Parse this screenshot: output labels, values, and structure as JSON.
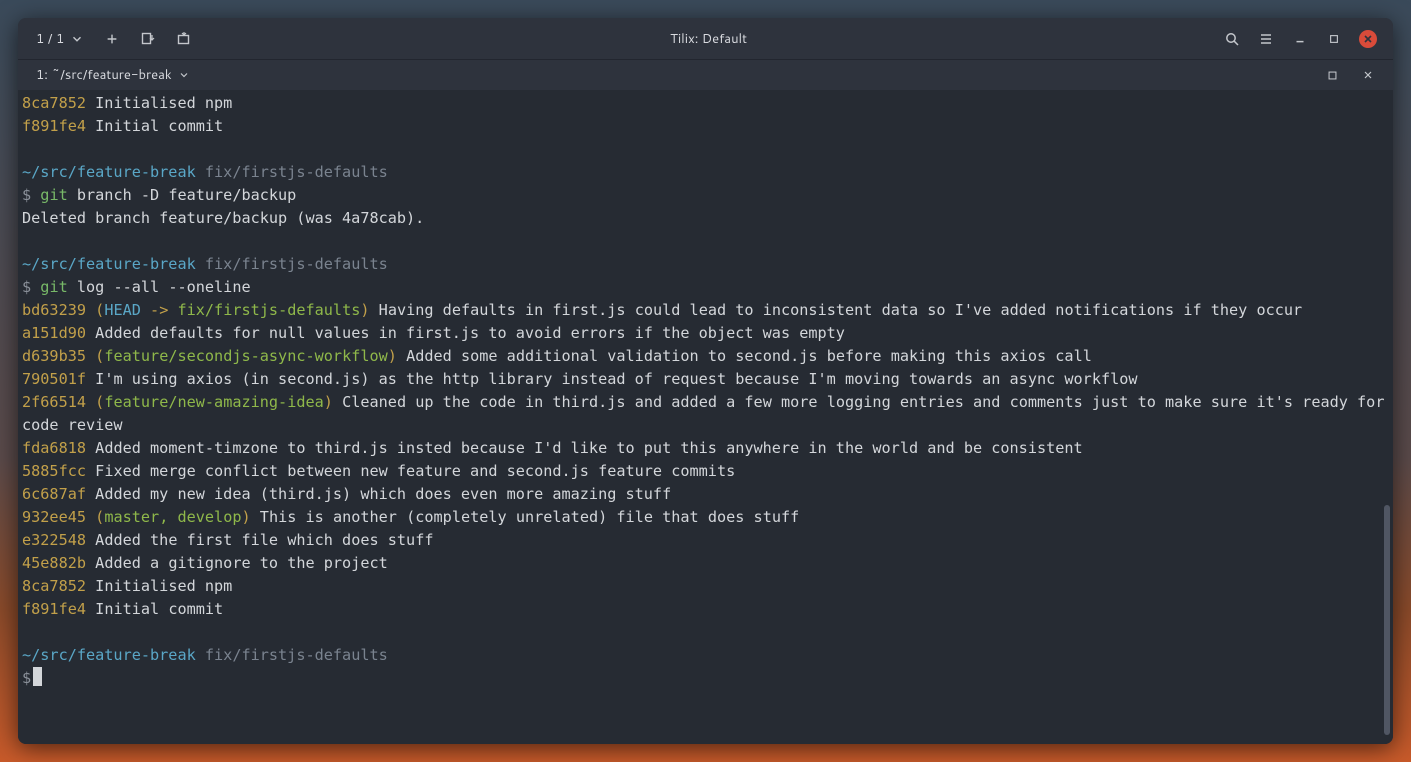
{
  "window": {
    "title": "Tilix: Default",
    "session_counter": "1 / 1"
  },
  "tab": {
    "label": "1: ~/src/feature-break"
  },
  "colors": {
    "hash": "#c2a04a",
    "path": "#5aa7c7",
    "branch_dim": "#7a838f",
    "git": "#78b968",
    "ref_head": "#5aa7c7",
    "ref_branch": "#8fb84a",
    "text": "#d3d6da"
  },
  "terminal": {
    "initial_log": [
      {
        "hash": "8ca7852",
        "msg": "Initialised npm"
      },
      {
        "hash": "f891fe4",
        "msg": "Initial commit"
      }
    ],
    "prompt1": {
      "path": "~/src/feature-break",
      "branch": "fix/firstjs-defaults",
      "symbol": "$",
      "cmd_git": "git",
      "cmd_rest": " branch -D feature/backup"
    },
    "output1": "Deleted branch feature/backup (was 4a78cab).",
    "prompt2": {
      "path": "~/src/feature-break",
      "branch": "fix/firstjs-defaults",
      "symbol": "$",
      "cmd_git": "git",
      "cmd_rest": " log --all --oneline"
    },
    "log": [
      {
        "hash": "bd63239",
        "refs": {
          "head": "HEAD",
          "arrow": " -> ",
          "branch": "fix/firstjs-defaults"
        },
        "msg": "Having defaults in first.js could lead to inconsistent data so I've added notifications if they occur"
      },
      {
        "hash": "a151d90",
        "msg": "Added defaults for null values in first.js to avoid errors if the object was empty"
      },
      {
        "hash": "d639b35",
        "refs": {
          "branch": "feature/secondjs-async-workflow"
        },
        "msg": "Added some additional validation to second.js before making this axios call"
      },
      {
        "hash": "790501f",
        "msg": "I'm using axios (in second.js) as the http library instead of request because I'm moving towards an async workflow"
      },
      {
        "hash": "2f66514",
        "refs": {
          "branch": "feature/new-amazing-idea"
        },
        "msg": "Cleaned up the code in third.js and added a few more logging entries and comments just to make sure it's ready for code review"
      },
      {
        "hash": "fda6818",
        "msg": "Added moment-timzone to third.js insted because I'd like to put this anywhere in the world and be consistent"
      },
      {
        "hash": "5885fcc",
        "msg": "Fixed merge conflict between new feature and second.js feature commits"
      },
      {
        "hash": "6c687af",
        "msg": "Added my new idea (third.js) which does even more amazing stuff"
      },
      {
        "hash": "932ee45",
        "refs": {
          "branches": "master, develop"
        },
        "msg": "This is another (completely unrelated) file that does stuff"
      },
      {
        "hash": "e322548",
        "msg": "Added the first file which does stuff"
      },
      {
        "hash": "45e882b",
        "msg": "Added a gitignore to the project"
      },
      {
        "hash": "8ca7852",
        "msg": "Initialised npm"
      },
      {
        "hash": "f891fe4",
        "msg": "Initial commit"
      }
    ],
    "prompt3": {
      "path": "~/src/feature-break",
      "branch": "fix/firstjs-defaults",
      "symbol": "$"
    }
  }
}
